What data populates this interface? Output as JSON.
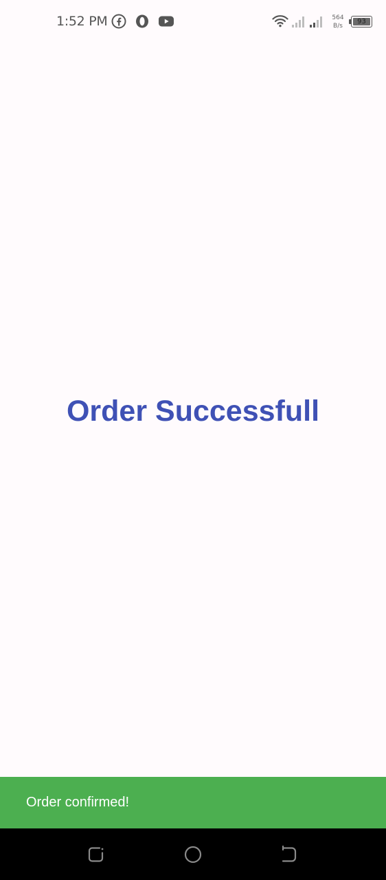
{
  "status_bar": {
    "time": "1:52 PM",
    "app_icons": [
      "facebook-icon",
      "opera-icon",
      "youtube-icon"
    ],
    "net_speed_value": "564",
    "net_speed_unit": "B/s",
    "battery_level": "93"
  },
  "main": {
    "title": "Order Successfull",
    "title_color": "#3f51b5"
  },
  "snackbar": {
    "message": "Order confirmed!",
    "background": "#4caf50"
  },
  "nav_bar": {
    "buttons": [
      "recents",
      "home",
      "back"
    ]
  }
}
